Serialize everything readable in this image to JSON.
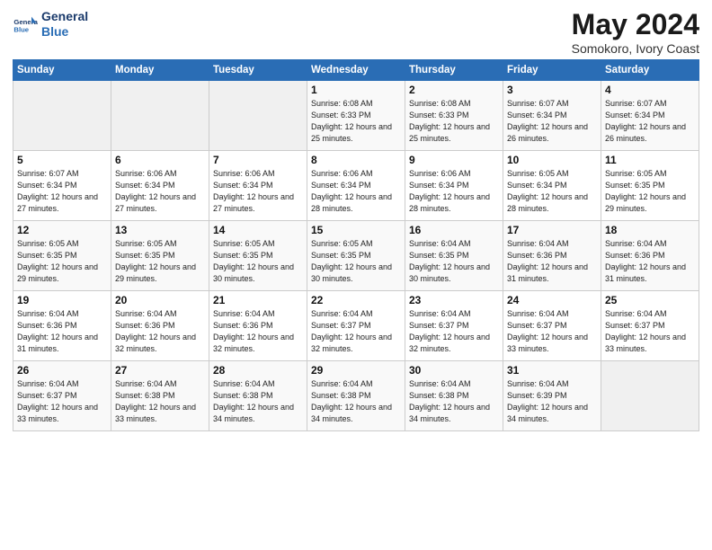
{
  "logo": {
    "line1": "General",
    "line2": "Blue"
  },
  "title": "May 2024",
  "location": "Somokoro, Ivory Coast",
  "days_header": [
    "Sunday",
    "Monday",
    "Tuesday",
    "Wednesday",
    "Thursday",
    "Friday",
    "Saturday"
  ],
  "weeks": [
    [
      {
        "day": "",
        "info": ""
      },
      {
        "day": "",
        "info": ""
      },
      {
        "day": "",
        "info": ""
      },
      {
        "day": "1",
        "info": "Sunrise: 6:08 AM\nSunset: 6:33 PM\nDaylight: 12 hours\nand 25 minutes."
      },
      {
        "day": "2",
        "info": "Sunrise: 6:08 AM\nSunset: 6:33 PM\nDaylight: 12 hours\nand 25 minutes."
      },
      {
        "day": "3",
        "info": "Sunrise: 6:07 AM\nSunset: 6:34 PM\nDaylight: 12 hours\nand 26 minutes."
      },
      {
        "day": "4",
        "info": "Sunrise: 6:07 AM\nSunset: 6:34 PM\nDaylight: 12 hours\nand 26 minutes."
      }
    ],
    [
      {
        "day": "5",
        "info": "Sunrise: 6:07 AM\nSunset: 6:34 PM\nDaylight: 12 hours\nand 27 minutes."
      },
      {
        "day": "6",
        "info": "Sunrise: 6:06 AM\nSunset: 6:34 PM\nDaylight: 12 hours\nand 27 minutes."
      },
      {
        "day": "7",
        "info": "Sunrise: 6:06 AM\nSunset: 6:34 PM\nDaylight: 12 hours\nand 27 minutes."
      },
      {
        "day": "8",
        "info": "Sunrise: 6:06 AM\nSunset: 6:34 PM\nDaylight: 12 hours\nand 28 minutes."
      },
      {
        "day": "9",
        "info": "Sunrise: 6:06 AM\nSunset: 6:34 PM\nDaylight: 12 hours\nand 28 minutes."
      },
      {
        "day": "10",
        "info": "Sunrise: 6:05 AM\nSunset: 6:34 PM\nDaylight: 12 hours\nand 28 minutes."
      },
      {
        "day": "11",
        "info": "Sunrise: 6:05 AM\nSunset: 6:35 PM\nDaylight: 12 hours\nand 29 minutes."
      }
    ],
    [
      {
        "day": "12",
        "info": "Sunrise: 6:05 AM\nSunset: 6:35 PM\nDaylight: 12 hours\nand 29 minutes."
      },
      {
        "day": "13",
        "info": "Sunrise: 6:05 AM\nSunset: 6:35 PM\nDaylight: 12 hours\nand 29 minutes."
      },
      {
        "day": "14",
        "info": "Sunrise: 6:05 AM\nSunset: 6:35 PM\nDaylight: 12 hours\nand 30 minutes."
      },
      {
        "day": "15",
        "info": "Sunrise: 6:05 AM\nSunset: 6:35 PM\nDaylight: 12 hours\nand 30 minutes."
      },
      {
        "day": "16",
        "info": "Sunrise: 6:04 AM\nSunset: 6:35 PM\nDaylight: 12 hours\nand 30 minutes."
      },
      {
        "day": "17",
        "info": "Sunrise: 6:04 AM\nSunset: 6:36 PM\nDaylight: 12 hours\nand 31 minutes."
      },
      {
        "day": "18",
        "info": "Sunrise: 6:04 AM\nSunset: 6:36 PM\nDaylight: 12 hours\nand 31 minutes."
      }
    ],
    [
      {
        "day": "19",
        "info": "Sunrise: 6:04 AM\nSunset: 6:36 PM\nDaylight: 12 hours\nand 31 minutes."
      },
      {
        "day": "20",
        "info": "Sunrise: 6:04 AM\nSunset: 6:36 PM\nDaylight: 12 hours\nand 32 minutes."
      },
      {
        "day": "21",
        "info": "Sunrise: 6:04 AM\nSunset: 6:36 PM\nDaylight: 12 hours\nand 32 minutes."
      },
      {
        "day": "22",
        "info": "Sunrise: 6:04 AM\nSunset: 6:37 PM\nDaylight: 12 hours\nand 32 minutes."
      },
      {
        "day": "23",
        "info": "Sunrise: 6:04 AM\nSunset: 6:37 PM\nDaylight: 12 hours\nand 32 minutes."
      },
      {
        "day": "24",
        "info": "Sunrise: 6:04 AM\nSunset: 6:37 PM\nDaylight: 12 hours\nand 33 minutes."
      },
      {
        "day": "25",
        "info": "Sunrise: 6:04 AM\nSunset: 6:37 PM\nDaylight: 12 hours\nand 33 minutes."
      }
    ],
    [
      {
        "day": "26",
        "info": "Sunrise: 6:04 AM\nSunset: 6:37 PM\nDaylight: 12 hours\nand 33 minutes."
      },
      {
        "day": "27",
        "info": "Sunrise: 6:04 AM\nSunset: 6:38 PM\nDaylight: 12 hours\nand 33 minutes."
      },
      {
        "day": "28",
        "info": "Sunrise: 6:04 AM\nSunset: 6:38 PM\nDaylight: 12 hours\nand 34 minutes."
      },
      {
        "day": "29",
        "info": "Sunrise: 6:04 AM\nSunset: 6:38 PM\nDaylight: 12 hours\nand 34 minutes."
      },
      {
        "day": "30",
        "info": "Sunrise: 6:04 AM\nSunset: 6:38 PM\nDaylight: 12 hours\nand 34 minutes."
      },
      {
        "day": "31",
        "info": "Sunrise: 6:04 AM\nSunset: 6:39 PM\nDaylight: 12 hours\nand 34 minutes."
      },
      {
        "day": "",
        "info": ""
      }
    ]
  ]
}
